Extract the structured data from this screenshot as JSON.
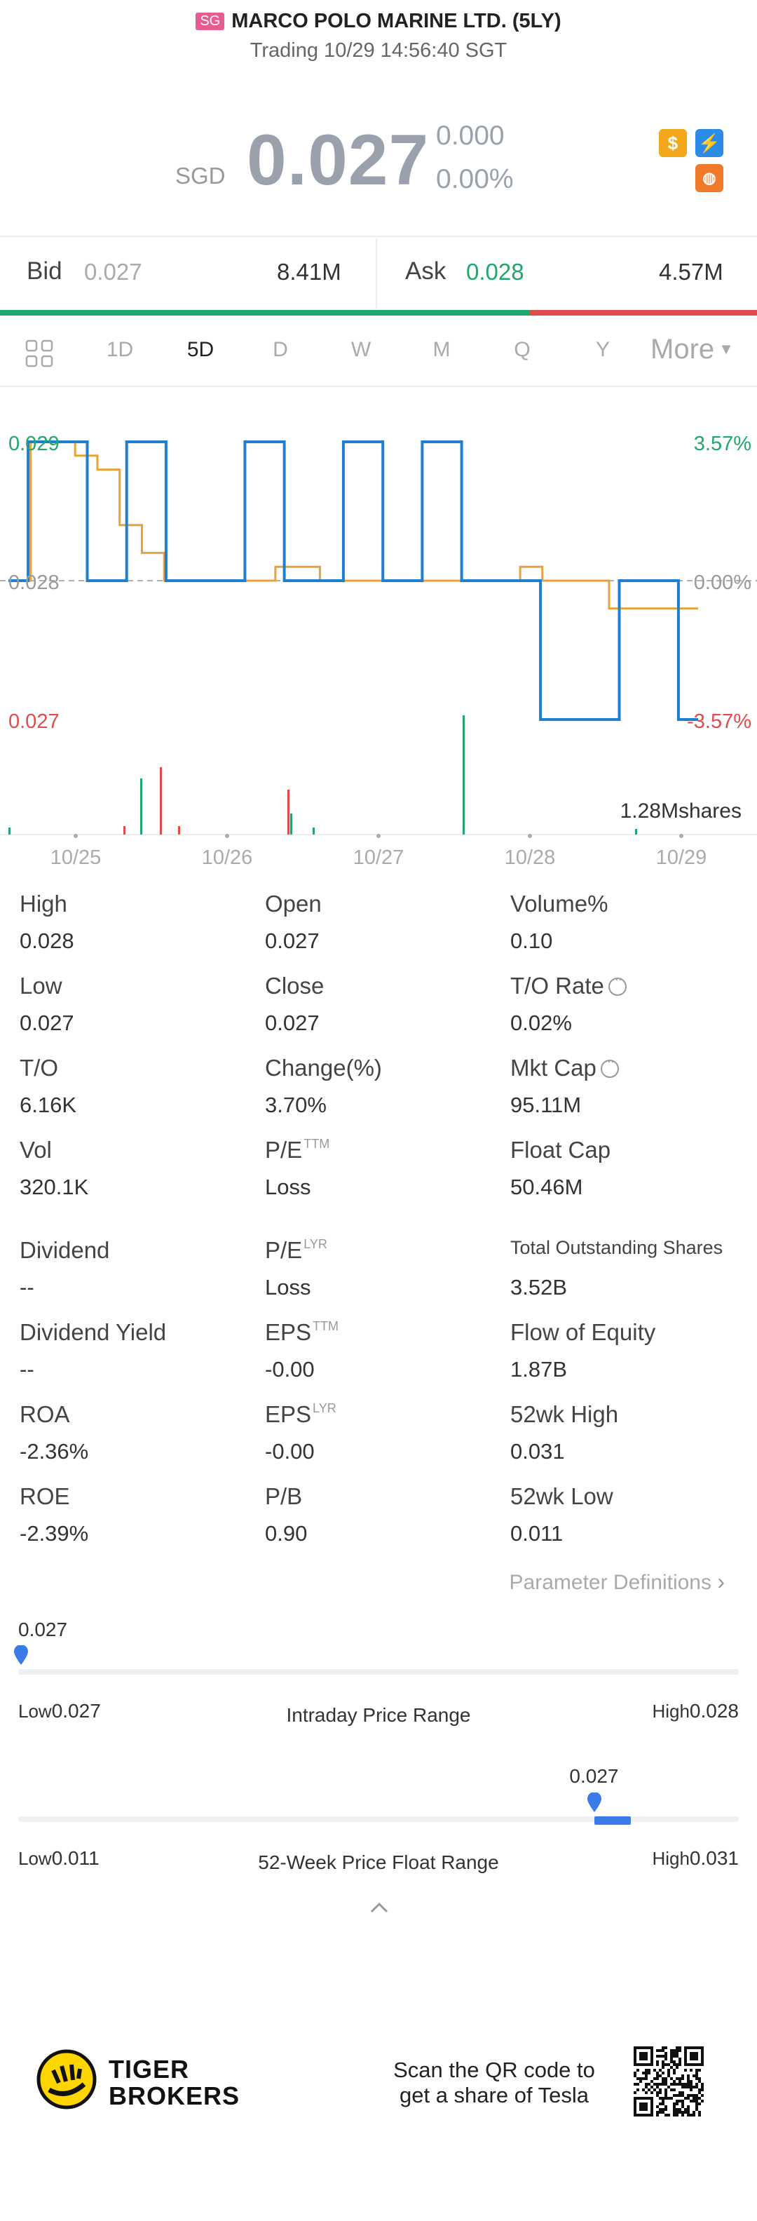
{
  "header": {
    "exchange_badge": "SG",
    "title": "MARCO POLO MARINE LTD. (5LY)",
    "subtitle": "Trading 10/29 14:56:40 SGT"
  },
  "quote": {
    "currency": "SGD",
    "price": "0.027",
    "change": "0.000",
    "change_pct": "0.00%",
    "icons": [
      "dollar-icon",
      "lightning-icon",
      "brain-icon"
    ]
  },
  "order_book": {
    "bid_label": "Bid",
    "bid_price": "0.027",
    "bid_size": "8.41M",
    "ask_label": "Ask",
    "ask_price": "0.028",
    "ask_size": "4.57M",
    "bid_ratio": 0.7
  },
  "tabs": {
    "items": [
      "1D",
      "5D",
      "D",
      "W",
      "M",
      "Q",
      "Y"
    ],
    "active": "5D",
    "more": "More"
  },
  "chart_data": {
    "type": "line",
    "x_labels": [
      "10/25",
      "10/26",
      "10/27",
      "10/28",
      "10/29"
    ],
    "y_left_labels": [
      "0.029",
      "0.028",
      "0.027"
    ],
    "y_right_labels": [
      "3.57%",
      "0.00%",
      "-3.57%"
    ],
    "ylim": [
      0.027,
      0.029
    ],
    "volume_label": "1.28Mshares",
    "series": [
      {
        "values": [
          0.028,
          0.029,
          0.029,
          0.029,
          0.028,
          0.028,
          0.029,
          0.029,
          0.028,
          0.028,
          0.028,
          0.028,
          0.029,
          0.029,
          0.028,
          0.028,
          0.028,
          0.029,
          0.029,
          0.028,
          0.028,
          0.029,
          0.029,
          0.028,
          0.028,
          0.028,
          0.028,
          0.027,
          0.027,
          0.027,
          0.027,
          0.028,
          0.028,
          0.028,
          0.027
        ]
      },
      {
        "values": [
          0.028,
          0.029,
          0.029,
          0.0289,
          0.0288,
          0.0284,
          0.0282,
          0.028,
          0.028,
          0.028,
          0.028,
          0.028,
          0.0281,
          0.0281,
          0.028,
          0.028,
          0.028,
          0.028,
          0.028,
          0.028,
          0.028,
          0.028,
          0.028,
          0.0281,
          0.028,
          0.028,
          0.028,
          0.0278,
          0.0278,
          0.0278,
          0.0278
        ]
      }
    ],
    "colors": {
      "price": "#1e7fd0",
      "avg": "#e9a23b",
      "up": "#1fa76c",
      "down": "#e04b4b"
    }
  },
  "stats": [
    {
      "label": "High",
      "value": "0.028"
    },
    {
      "label": "Open",
      "value": "0.027"
    },
    {
      "label": "Volume%",
      "value": "0.10"
    },
    {
      "label": "Low",
      "value": "0.027"
    },
    {
      "label": "Close",
      "value": "0.027"
    },
    {
      "label": "T/O Rate",
      "value": "0.02%"
    },
    {
      "label": "T/O",
      "value": "6.16K"
    },
    {
      "label": "Change(%)",
      "value": "3.70%"
    },
    {
      "label": "Mkt Cap",
      "value": "95.11M"
    },
    {
      "label": "Vol",
      "value": "320.1K"
    },
    {
      "label": "P/E",
      "sup": "TTM",
      "value": "Loss"
    },
    {
      "label": "Float Cap",
      "value": "50.46M"
    },
    {
      "label": "Dividend",
      "value": "--"
    },
    {
      "label": "P/E",
      "sup": "LYR",
      "value": "Loss"
    },
    {
      "label": "Total Outstanding Shares",
      "value": "3.52B"
    },
    {
      "label": "Dividend Yield",
      "value": "--"
    },
    {
      "label": "EPS",
      "sup": "TTM",
      "value": "-0.00"
    },
    {
      "label": "Flow of Equity",
      "value": "1.87B"
    },
    {
      "label": "ROA",
      "value": "-2.36%"
    },
    {
      "label": "EPS",
      "sup": "LYR",
      "value": "-0.00"
    },
    {
      "label": "52wk High",
      "value": "0.031"
    },
    {
      "label": "ROE",
      "value": "-2.39%"
    },
    {
      "label": "P/B",
      "value": "0.90"
    },
    {
      "label": "52wk Low",
      "value": "0.011"
    }
  ],
  "param_link": "Parameter Definitions",
  "intraday_range": {
    "current": "0.027",
    "low_label": "Low",
    "low": "0.027",
    "high_label": "High",
    "high": "0.028",
    "title": "Intraday Price Range",
    "position": 0.0
  },
  "week52_range": {
    "current": "0.027",
    "low_label": "Low",
    "low": "0.011",
    "high_label": "High",
    "high": "0.031",
    "title": "52-Week Price Float Range",
    "position": 0.8
  },
  "footer": {
    "brand_line1": "TIGER",
    "brand_line2": "BROKERS",
    "promo_line1": "Scan the QR code to",
    "promo_line2": "get a share of Tesla"
  }
}
